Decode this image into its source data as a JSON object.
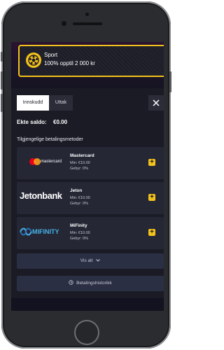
{
  "bonus": {
    "title": "Sport",
    "subtitle": "100% opptil 2 000 kr"
  },
  "tabs": {
    "deposit": "Innskudd",
    "withdraw": "Uttak"
  },
  "balance": {
    "label": "Ekte saldo:",
    "value": "€0.00"
  },
  "methods_title": "Tilgjengelige betalingsmetoder",
  "methods": [
    {
      "name": "Mastercard",
      "min": "Min: €10.00",
      "fee": "Gebyr: 0%",
      "logo_text": "mastercard"
    },
    {
      "name": "Jeton",
      "min": "Min: €10.00",
      "fee": "Gebyr: 0%",
      "logo_text": "Jetonbank"
    },
    {
      "name": "MiFinity",
      "min": "Min: €10.00",
      "fee": "Gebyr: 0%",
      "logo_text": "MIFINITY"
    }
  ],
  "show_all": "Vis alt",
  "history": "Betalingshistorikk",
  "colors": {
    "accent": "#f2c11c",
    "panel": "#1a1b25",
    "card": "#252735"
  }
}
